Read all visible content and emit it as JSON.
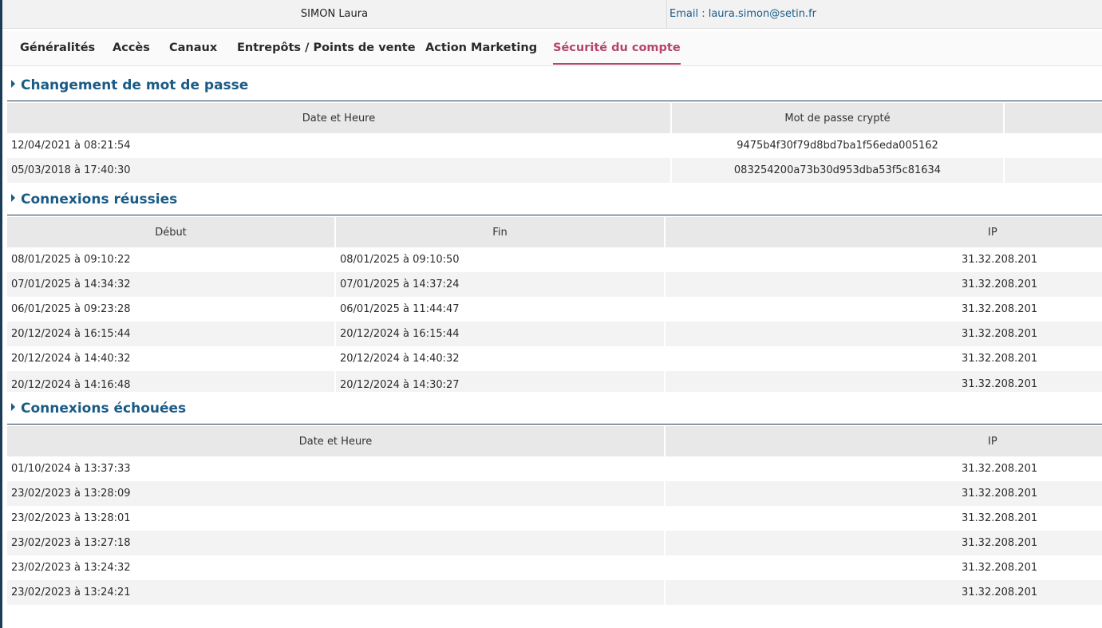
{
  "header": {
    "user_name": "SIMON Laura",
    "email": "Email : laura.simon@setin.fr"
  },
  "tabs": [
    {
      "label": "Généralités"
    },
    {
      "label": "Accès"
    },
    {
      "label": "Canaux"
    },
    {
      "label": "Entrepôts / Points de vente"
    },
    {
      "label": "Action Marketing"
    },
    {
      "label": "Sécurité du compte",
      "active": true
    }
  ],
  "password_changes": {
    "title": "Changement de mot de passe",
    "columns": [
      "Date et Heure",
      "Mot de passe crypté",
      ""
    ],
    "rows": [
      [
        "12/04/2021 à 08:21:54",
        "9475b4f30f79d8bd7ba1f56eda005162"
      ],
      [
        "05/03/2018 à 17:40:30",
        "083254200a73b30d953dba53f5c81634"
      ]
    ]
  },
  "successful_logins": {
    "title": "Connexions réussies",
    "columns": [
      "Début",
      "Fin",
      "IP"
    ],
    "rows": [
      [
        "08/01/2025 à 09:10:22",
        "08/01/2025 à 09:10:50",
        "31.32.208.201"
      ],
      [
        "07/01/2025 à 14:34:32",
        "07/01/2025 à 14:37:24",
        "31.32.208.201"
      ],
      [
        "06/01/2025 à 09:23:28",
        "06/01/2025 à 11:44:47",
        "31.32.208.201"
      ],
      [
        "20/12/2024 à 16:15:44",
        "20/12/2024 à 16:15:44",
        "31.32.208.201"
      ],
      [
        "20/12/2024 à 14:40:32",
        "20/12/2024 à 14:40:32",
        "31.32.208.201"
      ],
      [
        "20/12/2024 à 14:16:48",
        "20/12/2024 à 14:30:27",
        "31.32.208.201"
      ]
    ]
  },
  "failed_logins": {
    "title": "Connexions échouées",
    "columns": [
      "Date et Heure",
      "IP"
    ],
    "rows": [
      [
        "01/10/2024 à 13:37:33",
        "31.32.208.201"
      ],
      [
        "23/02/2023 à 13:28:09",
        "31.32.208.201"
      ],
      [
        "23/02/2023 à 13:28:01",
        "31.32.208.201"
      ],
      [
        "23/02/2023 à 13:27:18",
        "31.32.208.201"
      ],
      [
        "23/02/2023 à 13:24:32",
        "31.32.208.201"
      ],
      [
        "23/02/2023 à 13:24:21",
        "31.32.208.201"
      ]
    ]
  },
  "colors": {
    "accent": "#b5446e",
    "title": "#1a5b86",
    "sidebar": "#1c3b57"
  }
}
